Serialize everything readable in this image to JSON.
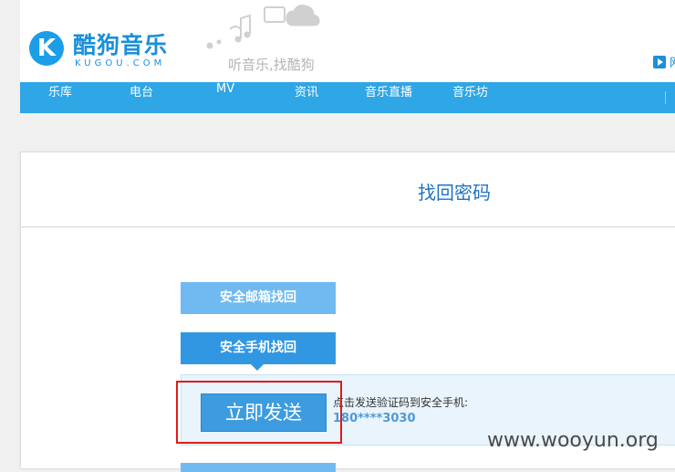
{
  "header": {
    "logo_letter": "K",
    "logo_cn": "酷狗音乐",
    "logo_en": "KUGOU.COM",
    "slogan": "听音乐,找酷狗",
    "play_link": "网"
  },
  "nav": {
    "items": [
      "乐库",
      "电台",
      "MV",
      "资讯",
      "音乐直播",
      "音乐坊"
    ]
  },
  "card": {
    "title": "找回密码",
    "option_email": "安全邮箱找回",
    "option_phone": "安全手机找回",
    "send_button": "立即发送",
    "hint": "点击发送验证码到安全手机:",
    "phone": "180****3030"
  },
  "watermark": "www.wooyun.org",
  "colors": {
    "brand_blue": "#1a8fdc",
    "nav_bg": "#2fa6e6",
    "button_blue": "#3d9be0",
    "highlight_red": "#e01b1b"
  }
}
